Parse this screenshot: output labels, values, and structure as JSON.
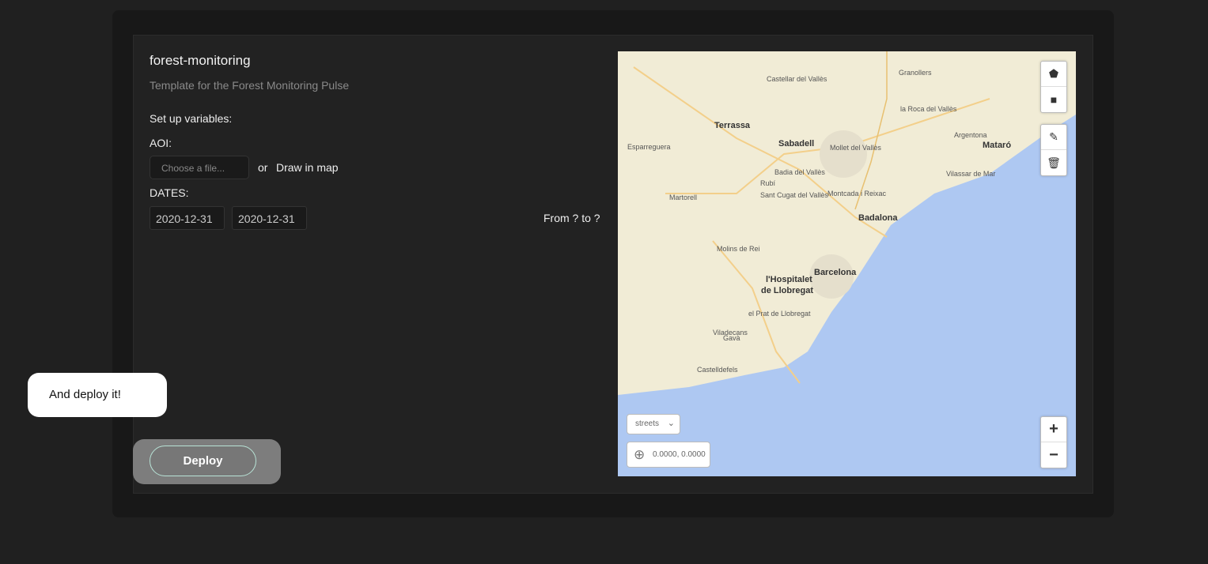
{
  "template": {
    "title": "forest-monitoring",
    "description": "Template for the Forest Monitoring Pulse",
    "setup_label": "Set up variables:",
    "aoi_label": "AOI:",
    "file_placeholder": "Choose a file...",
    "or_text": "or",
    "draw_in_map": "Draw in map",
    "dates_label": "DATES:",
    "date_from": "2020-12-31",
    "date_to": "2020-12-31",
    "range_text": "From ? to ?"
  },
  "map": {
    "style_select": "streets",
    "coordinates": "0.0000, 0.0000",
    "zoom_in": "+",
    "zoom_out": "−",
    "labels": [
      {
        "text": "Terrassa",
        "big": true
      },
      {
        "text": "Sabadell",
        "big": true
      },
      {
        "text": "Badalona",
        "big": true
      },
      {
        "text": "Barcelona",
        "big": true
      },
      {
        "text": "l'Hospitalet",
        "big": true
      },
      {
        "text": "de Llobregat",
        "big": true
      },
      {
        "text": "Mataró",
        "big": true
      },
      {
        "text": "Castellar del Vallès",
        "big": false
      },
      {
        "text": "Rubí",
        "big": false
      },
      {
        "text": "Sant Cugat del Vallès",
        "big": false
      },
      {
        "text": "Badia del Vallès",
        "big": false
      },
      {
        "text": "Mollet del Vallès",
        "big": false
      },
      {
        "text": "Granollers",
        "big": false
      },
      {
        "text": "Martorell",
        "big": false
      },
      {
        "text": "Molins de Rei",
        "big": false
      },
      {
        "text": "el Prat de Llobregat",
        "big": false
      },
      {
        "text": "Viladecans",
        "big": false
      },
      {
        "text": "Gavà",
        "big": false
      },
      {
        "text": "Castelldefels",
        "big": false
      },
      {
        "text": "Esparreguera",
        "big": false
      },
      {
        "text": "Vilassar de Mar",
        "big": false
      },
      {
        "text": "Montcada i Reixac",
        "big": false
      },
      {
        "text": "la Roca del Vallès",
        "big": false
      },
      {
        "text": "Argentona",
        "big": false
      }
    ]
  },
  "tooltip": "And deploy it!",
  "deploy_label": "Deploy",
  "colors": {
    "land": "#f1ecd6",
    "sea": "#aec8f2",
    "accent": "#b8e3d6"
  }
}
